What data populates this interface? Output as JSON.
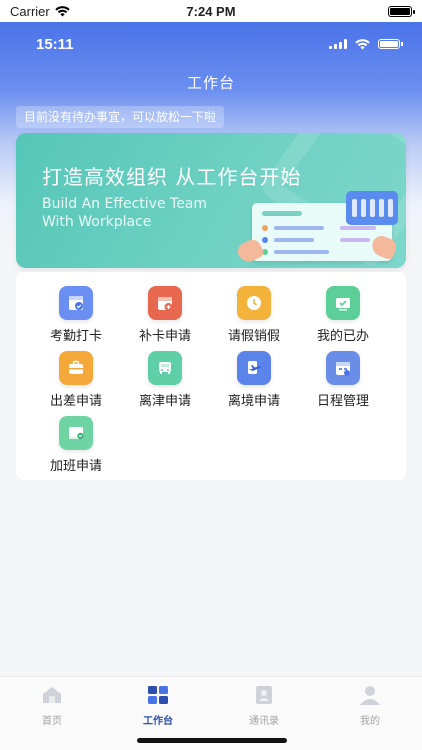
{
  "statusbar": {
    "carrier": "Carrier",
    "time": "7:24 PM"
  },
  "app": {
    "inner_time": "15:11",
    "title": "工作台",
    "notice": "目前没有待办事宜，可以放松一下啦"
  },
  "banner": {
    "title": "打造高效组织 从工作台开始",
    "subtitle_line1": "Build An Effective Team",
    "subtitle_line2": "With Workplace"
  },
  "grid": [
    {
      "label": "考勤打卡",
      "icon": "attendance-clock-icon",
      "color": "#6b8ef2"
    },
    {
      "label": "补卡申请",
      "icon": "card-reissue-icon",
      "color": "#e8674f"
    },
    {
      "label": "请假销假",
      "icon": "leave-clock-icon",
      "color": "#f3b23a"
    },
    {
      "label": "我的已办",
      "icon": "done-tasks-icon",
      "color": "#5ccf98"
    },
    {
      "label": "出差申请",
      "icon": "briefcase-icon",
      "color": "#f5a83a"
    },
    {
      "label": "离津申请",
      "icon": "car-icon",
      "color": "#5fcfa7"
    },
    {
      "label": "离境申请",
      "icon": "plane-icon",
      "color": "#5b84ea"
    },
    {
      "label": "日程管理",
      "icon": "calendar-icon",
      "color": "#6a8de8"
    },
    {
      "label": "加班申请",
      "icon": "overtime-monitor-icon",
      "color": "#6fd4a3"
    }
  ],
  "tabs": [
    {
      "label": "首页",
      "icon": "home-icon",
      "active": false
    },
    {
      "label": "工作台",
      "icon": "workbench-icon",
      "active": true
    },
    {
      "label": "通讯录",
      "icon": "contacts-icon",
      "active": false
    },
    {
      "label": "我的",
      "icon": "profile-icon",
      "active": false
    }
  ],
  "colors": {
    "primary": "#4a73e8",
    "banner": "#5fcbbd",
    "active_tab": "#2f4fae"
  }
}
